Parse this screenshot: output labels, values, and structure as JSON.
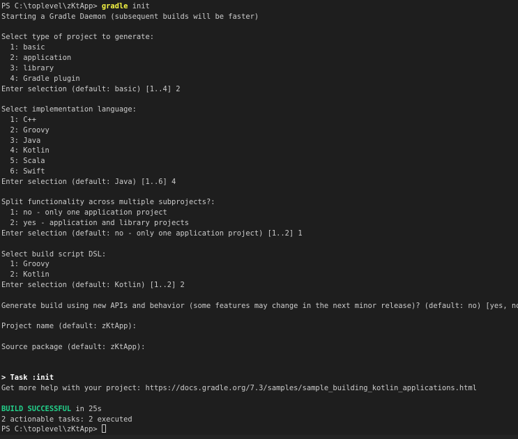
{
  "terminal": {
    "shell": "PowerShell",
    "background_color": "#1e1e1e",
    "foreground_color": "#cccccc",
    "accent_colors": {
      "command_yellow": "#f5f543",
      "success_green": "#23d18b",
      "bold_white": "#ffffff"
    },
    "prompt_path": "PS C:\\toplevel\\zKtApp>",
    "cursor": "block-outline"
  },
  "lines": [
    {
      "id": "l0",
      "segments": [
        {
          "text": "PS C:\\toplevel\\zKtApp> ",
          "style": "white"
        },
        {
          "text": "gradle",
          "style": "yellow"
        },
        {
          "text": " init",
          "style": "white"
        }
      ]
    },
    {
      "id": "l1",
      "text": "Starting a Gradle Daemon (subsequent builds will be faster)"
    },
    {
      "id": "l2",
      "text": ""
    },
    {
      "id": "l3",
      "text": "Select type of project to generate:"
    },
    {
      "id": "l4",
      "text": "  1: basic"
    },
    {
      "id": "l5",
      "text": "  2: application"
    },
    {
      "id": "l6",
      "text": "  3: library"
    },
    {
      "id": "l7",
      "text": "  4: Gradle plugin"
    },
    {
      "id": "l8",
      "text": "Enter selection (default: basic) [1..4] 2"
    },
    {
      "id": "l9",
      "text": ""
    },
    {
      "id": "l10",
      "text": "Select implementation language:"
    },
    {
      "id": "l11",
      "text": "  1: C++"
    },
    {
      "id": "l12",
      "text": "  2: Groovy"
    },
    {
      "id": "l13",
      "text": "  3: Java"
    },
    {
      "id": "l14",
      "text": "  4: Kotlin"
    },
    {
      "id": "l15",
      "text": "  5: Scala"
    },
    {
      "id": "l16",
      "text": "  6: Swift"
    },
    {
      "id": "l17",
      "text": "Enter selection (default: Java) [1..6] 4"
    },
    {
      "id": "l18",
      "text": ""
    },
    {
      "id": "l19",
      "text": "Split functionality across multiple subprojects?:"
    },
    {
      "id": "l20",
      "text": "  1: no - only one application project"
    },
    {
      "id": "l21",
      "text": "  2: yes - application and library projects"
    },
    {
      "id": "l22",
      "text": "Enter selection (default: no - only one application project) [1..2] 1"
    },
    {
      "id": "l23",
      "text": ""
    },
    {
      "id": "l24",
      "text": "Select build script DSL:"
    },
    {
      "id": "l25",
      "text": "  1: Groovy"
    },
    {
      "id": "l26",
      "text": "  2: Kotlin"
    },
    {
      "id": "l27",
      "text": "Enter selection (default: Kotlin) [1..2] 2"
    },
    {
      "id": "l28",
      "text": ""
    },
    {
      "id": "l29",
      "text": "Generate build using new APIs and behavior (some features may change in the next minor release)? (default: no) [yes, no]"
    },
    {
      "id": "l30",
      "text": ""
    },
    {
      "id": "l31",
      "text": "Project name (default: zKtApp):"
    },
    {
      "id": "l32",
      "text": ""
    },
    {
      "id": "l33",
      "text": "Source package (default: zKtApp):"
    },
    {
      "id": "l34",
      "text": ""
    },
    {
      "id": "l35",
      "text": ""
    },
    {
      "id": "l36",
      "segments": [
        {
          "text": "> Task :init",
          "style": "bold"
        }
      ]
    },
    {
      "id": "l37",
      "text": "Get more help with your project: https://docs.gradle.org/7.3/samples/sample_building_kotlin_applications.html"
    },
    {
      "id": "l38",
      "text": ""
    },
    {
      "id": "l39",
      "segments": [
        {
          "text": "BUILD SUCCESSFUL",
          "style": "green"
        },
        {
          "text": " in 25s",
          "style": "white"
        }
      ]
    },
    {
      "id": "l40",
      "text": "2 actionable tasks: 2 executed"
    },
    {
      "id": "l41",
      "segments": [
        {
          "text": "PS C:\\toplevel\\zKtApp> ",
          "style": "white"
        },
        {
          "text": "",
          "style": "cursor"
        }
      ]
    }
  ]
}
